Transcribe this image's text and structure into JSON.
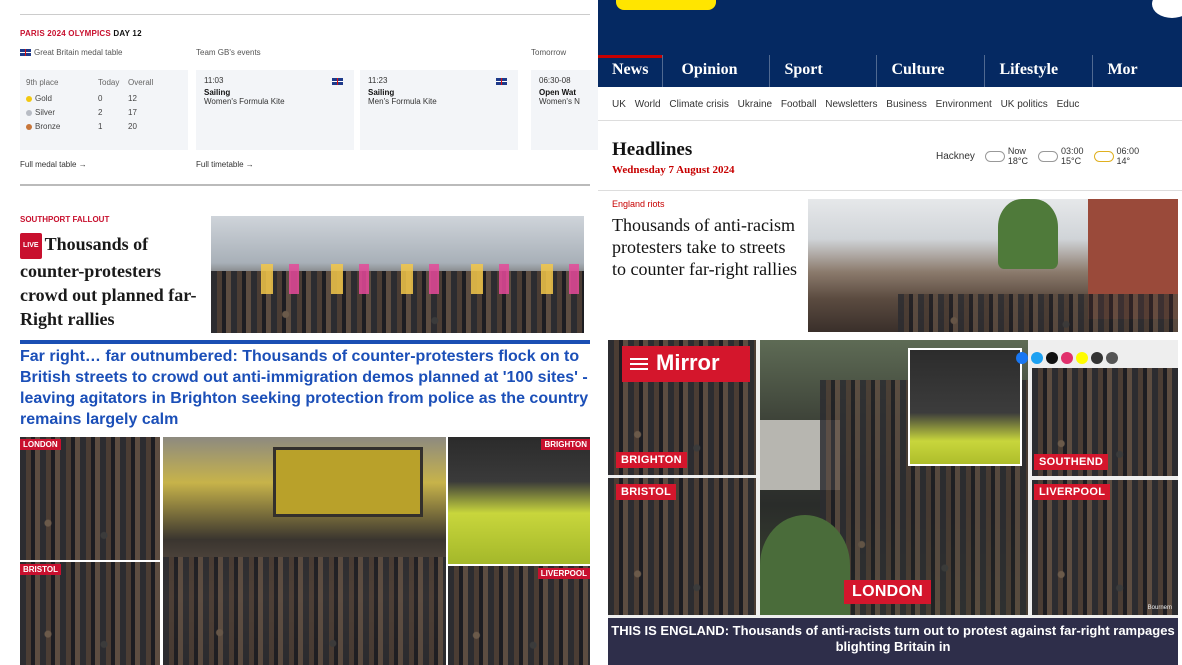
{
  "left": {
    "olympics": {
      "title_red": "PARIS 2024 OLYMPICS",
      "title_day": "DAY 12",
      "medal_table_label": "Great Britain medal table",
      "events_label": "Team GB's events",
      "tomorrow_label": "Tomorrow",
      "place": "9th place",
      "col_today": "Today",
      "col_overall": "Overall",
      "medals": [
        {
          "name": "Gold",
          "today": "0",
          "overall": "12",
          "color": "#f2c811"
        },
        {
          "name": "Silver",
          "today": "2",
          "overall": "17",
          "color": "#b8bcc4"
        },
        {
          "name": "Bronze",
          "today": "1",
          "overall": "20",
          "color": "#c8763a"
        }
      ],
      "events": [
        {
          "time": "11:03",
          "sport": "Sailing",
          "event": "Women's Formula Kite"
        },
        {
          "time": "11:23",
          "sport": "Sailing",
          "event": "Men's Formula Kite"
        },
        {
          "time": "06:30-08",
          "sport": "Open Wat",
          "event": "Women's N"
        }
      ],
      "full_medal_link": "Full medal table →",
      "full_timetable_link": "Full timetable →"
    },
    "kicker": "SOUTHPORT FALLOUT",
    "live_badge": "LIVE",
    "headline": "Thousands of counter-protesters crowd out planned far-Right rallies",
    "subheadline": "Far right… far outnumbered: Thousands of counter-protesters flock on to British streets to crowd out anti-immigration demos planned at '100 sites' - leaving agitators in Brighton seeking protection from police as the country remains largely calm",
    "tags": {
      "london": "LONDON",
      "bristol": "BRISTOL",
      "brighton": "BRIGHTON",
      "liverpool": "LIVERPOOL"
    }
  },
  "right": {
    "nav": [
      "News",
      "Opinion",
      "Sport",
      "Culture",
      "Lifestyle",
      "Mor"
    ],
    "subnav": [
      "UK",
      "World",
      "Climate crisis",
      "Ukraine",
      "Football",
      "Newsletters",
      "Business",
      "Environment",
      "UK politics",
      "Educ"
    ],
    "headlines_title": "Headlines",
    "date": "Wednesday 7 August 2024",
    "weather": {
      "location": "Hackney",
      "slots": [
        {
          "time": "Now",
          "temp": "18°C"
        },
        {
          "time": "03:00",
          "temp": "15°C"
        },
        {
          "time": "06:00",
          "temp": "14°"
        }
      ]
    },
    "kicker": "England riots",
    "headline": "Thousands of anti-racism protesters take to streets to counter far-right rallies",
    "mirror": {
      "logo": "Mirror",
      "tags": {
        "brighton": "BRIGHTON",
        "bristol": "BRISTOL",
        "london": "LONDON",
        "southend": "SOUTHEND",
        "liverpool": "LIVERPOOL"
      },
      "caption": "THIS IS ENGLAND: Thousands of anti-racists turn out to protest against far-right rampages blighting Britain in",
      "credit": "Bournem"
    }
  },
  "colors": {
    "telegraph_red": "#c8102e",
    "telegraph_blue": "#1b4fb8",
    "guardian_navy": "#052962",
    "guardian_red": "#c70000",
    "mirror_red": "#d4162c"
  }
}
